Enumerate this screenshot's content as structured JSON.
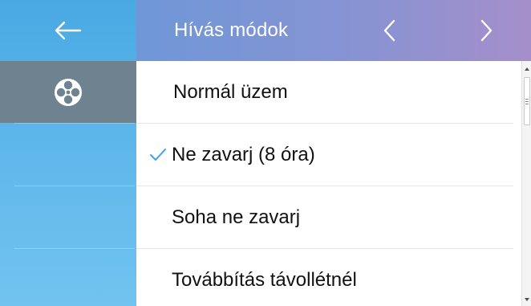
{
  "header": {
    "title": "Hívás módok",
    "back_icon": "arrow-left-icon",
    "prev_icon": "chevron-left-icon",
    "next_icon": "chevron-right-icon"
  },
  "sidebar": {
    "items": [
      {
        "icon": "reel-icon",
        "active": true
      },
      {
        "icon": "",
        "active": false
      },
      {
        "icon": "",
        "active": false
      }
    ]
  },
  "modes": {
    "items": [
      {
        "label": "Normál üzem",
        "selected": false
      },
      {
        "label": "Ne zavarj (8 óra)",
        "selected": true
      },
      {
        "label": "Soha ne zavarj",
        "selected": false
      },
      {
        "label": "Továbbítás távollétnél",
        "selected": false
      }
    ],
    "check_icon": "checkmark-icon"
  },
  "colors": {
    "sidebar": "#5bb5ea",
    "sidebar_active": "#6e8290",
    "header_start": "#6f97d8",
    "header_end": "#a58fca",
    "check": "#3da2e6",
    "text": "#111111"
  }
}
